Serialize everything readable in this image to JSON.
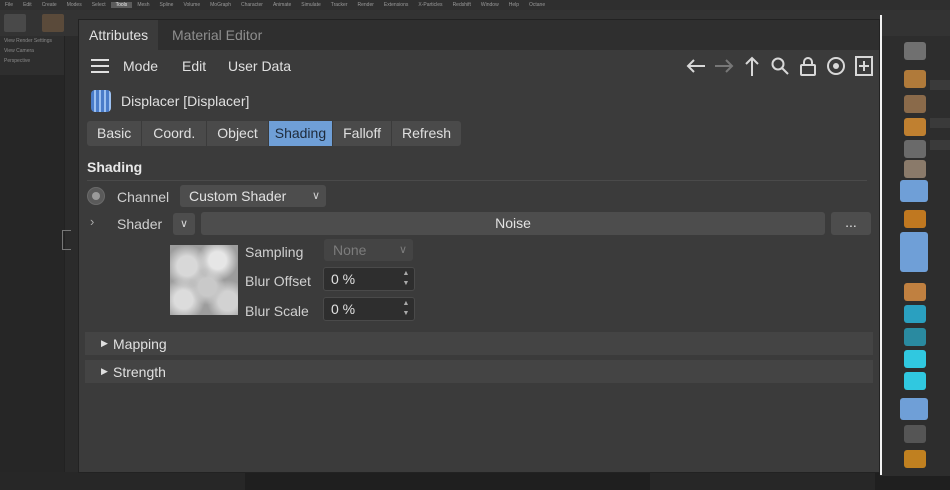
{
  "app_menu": [
    "File",
    "Edit",
    "Create",
    "Modes",
    "Select",
    "Tools",
    "Mesh",
    "Spline",
    "Volume",
    "MoGraph",
    "Character",
    "Animate",
    "Simulate",
    "Tracker",
    "Render",
    "Extensions",
    "X-Particles",
    "Redshift",
    "Window",
    "Help",
    "Octane"
  ],
  "app_menu_active": "Tools",
  "left_panel": {
    "row1": "View   Render Settings",
    "row2": "View   Camera",
    "row3": "Perspective"
  },
  "tabs": [
    "Attributes",
    "Material Editor"
  ],
  "menu": {
    "mode": "Mode",
    "edit": "Edit",
    "user_data": "User Data"
  },
  "nav_icons": [
    "arrow-left-icon",
    "arrow-right-icon",
    "arrow-up-icon",
    "search-icon",
    "lock-icon",
    "target-icon",
    "new-panel-icon"
  ],
  "object": {
    "title": "Displacer [Displacer]",
    "icon": "displacer-icon"
  },
  "page_tabs": [
    "Basic",
    "Coord.",
    "Object",
    "Shading",
    "Falloff",
    "Refresh"
  ],
  "active_page_tab": "Shading",
  "shading": {
    "section_title": "Shading",
    "channel_label": "Channel",
    "channel_value": "Custom Shader",
    "shader_label": "Shader",
    "shader_value": "Noise",
    "more_label": "...",
    "sampling_label": "Sampling",
    "sampling_value": "None",
    "blur_offset_label": "Blur Offset",
    "blur_offset_value": "0 %",
    "blur_scale_label": "Blur Scale",
    "blur_scale_value": "0 %"
  },
  "groups": {
    "mapping": "Mapping",
    "strength": "Strength"
  },
  "colors": {
    "accent": "#6f9fd7",
    "panel": "#3b3b3b",
    "tab_bar": "#2f2f2f"
  }
}
